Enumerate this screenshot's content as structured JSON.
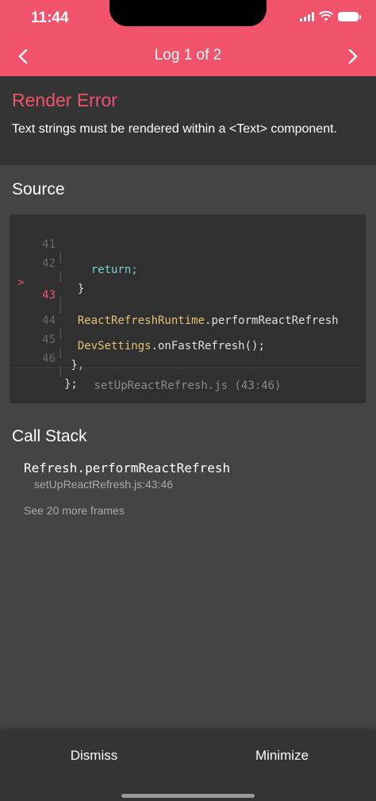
{
  "status": {
    "time": "11:44"
  },
  "nav": {
    "title": "Log 1 of 2"
  },
  "error": {
    "title": "Render Error",
    "message": "Text strings must be rendered within a <Text> component."
  },
  "source": {
    "title": "Source",
    "lines": [
      {
        "num": "41",
        "marker": "",
        "code": "    return;",
        "color": "#7ecfd3"
      },
      {
        "num": "42",
        "marker": "",
        "code": "  }",
        "color": "#e0e0e0"
      },
      {
        "num": "43",
        "marker": ">",
        "code": "  ReactRefreshRuntime.performReactRefresh",
        "color": "#e5c07b"
      },
      {
        "num": "",
        "marker": "",
        "code": "",
        "color": "#e0e0e0"
      },
      {
        "num": "44",
        "marker": "",
        "code": "  DevSettings.onFastRefresh();",
        "color": "#e5c07b"
      },
      {
        "num": "45",
        "marker": "",
        "code": " },",
        "color": "#e0e0e0"
      },
      {
        "num": "46",
        "marker": "",
        "code": "};",
        "color": "#e0e0e0"
      }
    ],
    "file": "setUpReactRefresh.js (43:46)"
  },
  "callstack": {
    "title": "Call Stack",
    "frame_name": "Refresh.performReactRefresh",
    "frame_location": "setUpReactRefresh.js:43:46",
    "see_more": "See 20 more frames"
  },
  "footer": {
    "dismiss": "Dismiss",
    "minimize": "Minimize"
  },
  "colors": {
    "accent": "#f0536b",
    "background": "#444444",
    "panel": "#343434"
  },
  "icons": {
    "back": "chevron-left-icon",
    "forward": "chevron-right-icon",
    "wifi": "wifi-icon",
    "signal": "signal-icon",
    "battery": "battery-icon"
  }
}
